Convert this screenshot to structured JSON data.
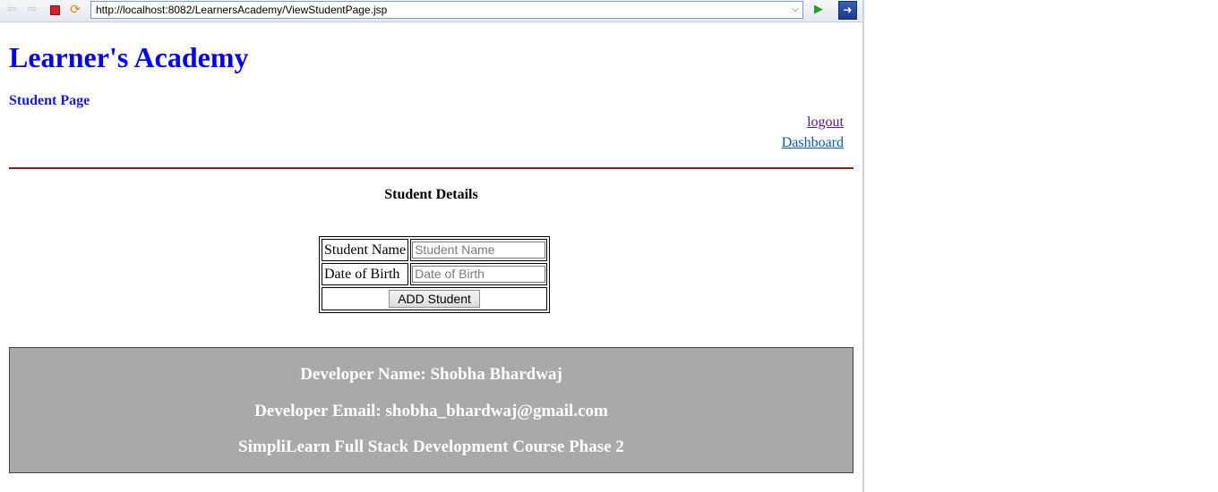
{
  "browser": {
    "url": "http://localhost:8082/LearnersAcademy/ViewStudentPage.jsp"
  },
  "header": {
    "site_title": "Learner's Academy",
    "page_subtitle": "Student Page"
  },
  "nav": {
    "logout": "logout",
    "dashboard": "Dashboard"
  },
  "main": {
    "section_title": "Student Details",
    "form": {
      "student_name_label": "Student Name",
      "student_name_placeholder": "Student Name",
      "student_name_value": "",
      "dob_label": "Date of Birth",
      "dob_placeholder": "Date of Birth",
      "dob_value": "",
      "submit_label": "ADD Student"
    }
  },
  "footer": {
    "developer_name": "Developer Name: Shobha Bhardwaj",
    "developer_email": "Developer Email: shobha_bhardwaj@gmail.com",
    "course": "SimpliLearn Full Stack Development Course Phase 2"
  },
  "icons": {
    "back": "back-arrow-icon",
    "forward": "forward-arrow-icon",
    "stop": "stop-icon",
    "reload": "reload-icon",
    "go": "go-arrow-icon",
    "extension": "extension-icon"
  },
  "colors": {
    "title_blue": "#0000ee",
    "rule_red": "#a0141a",
    "footer_gray": "#a9a9a9"
  }
}
